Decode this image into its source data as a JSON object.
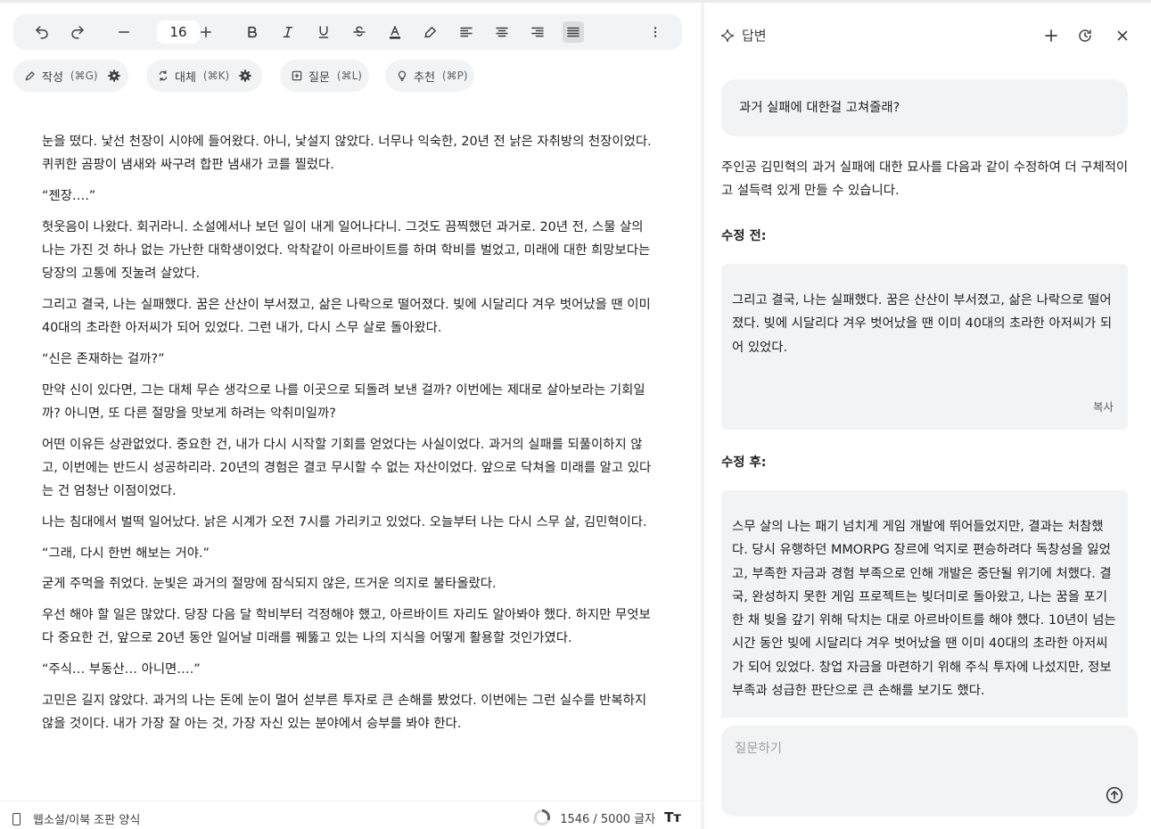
{
  "toolbar": {
    "font_size": "16",
    "buttons": [
      "undo-icon",
      "redo-icon",
      "decrease-icon",
      "increase-icon",
      "bold-icon",
      "italic-icon",
      "underline-icon",
      "strikethrough-icon",
      "text-color-icon",
      "highlighter-icon",
      "align-left-icon",
      "align-center-icon",
      "align-right-icon",
      "align-justify-icon",
      "more-icon"
    ],
    "text_color_bar": "#202124"
  },
  "chips": {
    "write": {
      "label": "작성",
      "shortcut": "(⌘G)"
    },
    "replace": {
      "label": "대체",
      "shortcut": "(⌘K)"
    },
    "question": {
      "label": "질문",
      "shortcut": "(⌘L)"
    },
    "suggest": {
      "label": "추천",
      "shortcut": "(⌘P)"
    }
  },
  "document": {
    "paragraphs": [
      "눈을 떴다. 낯선 천장이 시야에 들어왔다. 아니, 낯설지 않았다. 너무나 익숙한, 20년 전 낡은 자취방의 천장이었다. 퀴퀴한 곰팡이 냄새와 싸구려 합판 냄새가 코를 찔렀다.",
      "“젠장….”",
      "헛웃음이 나왔다. 회귀라니. 소설에서나 보던 일이 내게 일어나다니. 그것도 끔찍했던 과거로. 20년 전, 스물 살의 나는 가진 것 하나 없는 가난한 대학생이었다. 악착같이 아르바이트를 하며 학비를 벌었고, 미래에 대한 희망보다는 당장의 고통에 짓눌려 살았다.",
      "그리고 결국, 나는 실패했다. 꿈은 산산이 부서졌고, 삶은 나락으로 떨어졌다. 빚에 시달리다 겨우 벗어났을 땐 이미 40대의 초라한 아저씨가 되어 있었다. 그런 내가, 다시 스무 살로 돌아왔다.",
      "“신은 존재하는 걸까?”",
      "만약 신이 있다면, 그는 대체 무슨 생각으로 나를 이곳으로 되돌려 보낸 걸까? 이번에는 제대로 살아보라는 기회일까? 아니면, 또 다른 절망을 맛보게 하려는 악취미일까?",
      "어떤 이유든 상관없었다. 중요한 건, 내가 다시 시작할 기회를 얻었다는 사실이었다. 과거의 실패를 되풀이하지 않고, 이번에는 반드시 성공하리라. 20년의 경험은 결코 무시할 수 없는 자산이었다. 앞으로 닥쳐올 미래를 알고 있다는 건 엄청난 이점이었다.",
      "나는 침대에서 벌떡 일어났다. 낡은 시계가 오전 7시를 가리키고 있었다. 오늘부터 나는 다시 스무 살, 김민혁이다.",
      "“그래, 다시 한번 해보는 거야.”",
      "굳게 주먹을 쥐었다. 눈빛은 과거의 절망에 잠식되지 않은, 뜨거운 의지로 불타올랐다.",
      "우선 해야 할 일은 많았다. 당장 다음 달 학비부터 걱정해야 했고, 아르바이트 자리도 알아봐야 했다. 하지만 무엇보다 중요한 건, 앞으로 20년 동안 일어날 미래를 꿰뚫고 있는 나의 지식을 어떻게 활용할 것인가였다.",
      "“주식… 부동산… 아니면….”",
      "고민은 길지 않았다. 과거의 나는 돈에 눈이 멀어 섣부른 투자로 큰 손해를 봤었다. 이번에는 그런 실수를 반복하지 않을 것이다. 내가 가장 잘 아는 것, 가장 자신 있는 분야에서 승부를 봐야 한다."
    ]
  },
  "status": {
    "format": "웹소설/이북 조판 양식",
    "count": "1546 / 5000 글자",
    "progress": 0.309,
    "tt": "Tт"
  },
  "panel": {
    "title": "답변",
    "user_question": "과거 실패에 대한걸 고쳐줄래?",
    "intro": "주인공 김민혁의 과거 실패에 대한 묘사를 다음과 같이 수정하여 더 구체적이고 설득력 있게 만들 수 있습니다.",
    "before_heading": "수정 전:",
    "before_text": "그리고 결국, 나는 실패했다. 꿈은 산산이 부서졌고, 삶은 나락으로 떨어졌다. 빚에 시달리다 겨우 벗어났을 땐 이미 40대의 초라한 아저씨가 되어 있었다.",
    "copy_label": "복사",
    "after_heading": "수정 후:",
    "after_text": "스무 살의 나는 패기 넘치게 게임 개발에 뛰어들었지만, 결과는 처참했다. 당시 유행하던 MMORPG 장르에 억지로 편승하려다 독창성을 잃었고, 부족한 자금과 경험 부족으로 인해 개발은 중단될 위기에 처했다. 결국, 완성하지 못한 게임 프로젝트는 빚더미로 돌아왔고, 나는 꿈을 포기한 채 빚을 갚기 위해 닥치는 대로 아르바이트를 해야 했다. 10년이 넘는 시간 동안 빚에 시달리다 겨우 벗어났을 땐 이미 40대의 초라한 아저씨가 되어 있었다. 창업 자금을 마련하기 위해 주식 투자에 나섰지만, 정보 부족과 성급한 판단으로 큰 손해를 보기도 했다.",
    "ask_placeholder": "질문하기"
  }
}
